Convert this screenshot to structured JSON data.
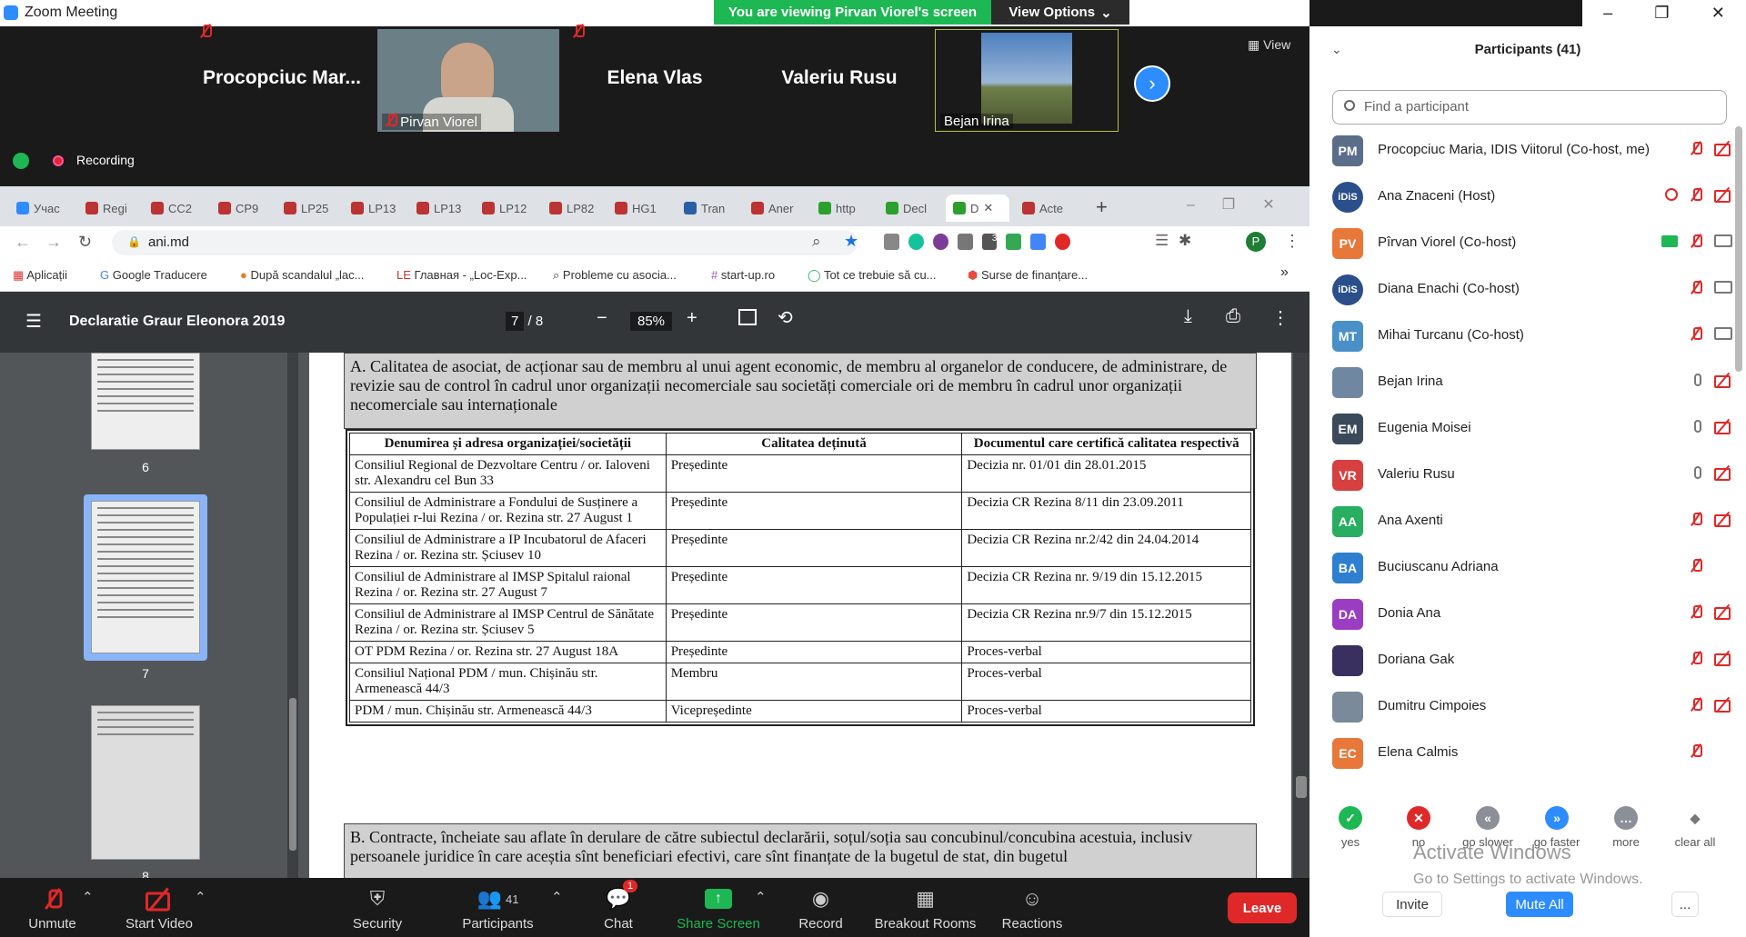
{
  "window": {
    "title": "Zoom Meeting"
  },
  "banner": {
    "viewing": "You are viewing Pirvan Viorel's screen",
    "view_options": "View Options"
  },
  "strip": {
    "tiles": [
      {
        "name": "Procopciuc Mar...",
        "caption": ""
      },
      {
        "name": "",
        "caption": "Pirvan Viorel"
      },
      {
        "name": "Elena Vlas",
        "caption": ""
      },
      {
        "name": "Valeriu Rusu",
        "caption": ""
      },
      {
        "name": "",
        "caption": "Bejan Irina"
      }
    ],
    "view_label": "View"
  },
  "recording": {
    "label": "Recording"
  },
  "browser": {
    "tabs": [
      "Учас",
      "Regi",
      "CC2",
      "CP9",
      "LP25",
      "LP13",
      "LP13",
      "LP12",
      "LP82",
      "HG1",
      "Tran",
      "Aner",
      "http",
      "Decl",
      "D",
      "Acte"
    ],
    "url": "ani.md",
    "bookmarks": [
      "Aplicații",
      "Google Traducere",
      "După scandalul „lac...",
      "Главная - „Loc-Exp...",
      "Probleme cu asocia...",
      "start-up.ro",
      "Tot ce trebuie să cu...",
      "Surse de finanțare..."
    ],
    "profile_initial": "P",
    "ext_badge": "3"
  },
  "pdf": {
    "doc_title": "Declaratie Graur Eleonora 2019",
    "page_current": "7",
    "page_total": "/ 8",
    "zoom": "85%",
    "thumbs": [
      "6",
      "7",
      "8"
    ],
    "section_a": "A. Calitatea de asociat, de acționar sau de membru al unui agent economic, de membru al organelor de conducere, de administrare, de revizie sau de control în cadrul unor organizații necomerciale sau societăți comerciale ori de membru în cadrul unor organizații necomerciale sau internaționale",
    "headers": [
      "Denumirea și adresa organizației/societății",
      "Calitatea deținută",
      "Documentul care certifică calitatea respectivă"
    ],
    "rows": [
      [
        "Consiliul Regional de Dezvoltare Centru / or. Ialoveni str. Alexandru cel Bun 33",
        "Președinte",
        "Decizia nr. 01/01 din 28.01.2015"
      ],
      [
        "Consiliul de Administrare a Fondului de Susținere a Populației r-lui Rezina / or. Rezina str. 27 August 1",
        "Președinte",
        "Decizia CR Rezina 8/11 din 23.09.2011"
      ],
      [
        "Consiliul de Administrare a IP Incubatorul de Afaceri Rezina / or. Rezina str. Șciusev 10",
        "Președinte",
        "Decizia CR Rezina nr.2/42 din 24.04.2014"
      ],
      [
        "Consiliul de Administrare al IMSP Spitalul raional Rezina / or. Rezina str. 27 August 7",
        "Președinte",
        "Decizia CR Rezina nr. 9/19 din 15.12.2015"
      ],
      [
        "Consiliul de Administrare al IMSP Centrul de Sănătate Rezina / or. Rezina str. Șciusev 5",
        "Președinte",
        "Decizia CR Rezina nr.9/7 din 15.12.2015"
      ],
      [
        "OT PDM Rezina / or. Rezina str. 27 August 18A",
        "Președinte",
        "Proces-verbal"
      ],
      [
        "Consiliul Național PDM / mun. Chișinău str. Armenească 44/3",
        "Membru",
        "Proces-verbal"
      ],
      [
        "PDM / mun. Chișinău str. Armenească 44/3",
        "Vicepreședinte",
        "Proces-verbal"
      ]
    ],
    "section_b": "B. Contracte, încheiate sau aflate în derulare de către subiectul declarării, soțul/soția sau concubinul/concubina acestuia, inclusiv persoanele juridice în care aceștia sînt beneficiari efectivi, care sînt finanțate de la bugetul de stat, din bugetul"
  },
  "toolbar": {
    "unmute": "Unmute",
    "start_video": "Start Video",
    "security": "Security",
    "participants": "Participants",
    "participants_count": "41",
    "chat": "Chat",
    "chat_badge": "1",
    "share_screen": "Share Screen",
    "record": "Record",
    "breakout": "Breakout Rooms",
    "reactions": "Reactions",
    "leave": "Leave"
  },
  "panel": {
    "title": "Participants (41)",
    "search_placeholder": "Find a participant",
    "participants": [
      {
        "initials": "PM",
        "name": "Procopciuc Maria, IDIS Viitorul (Co-host, me)",
        "color": "#5a6e8a",
        "mic": "off",
        "video": "off"
      },
      {
        "initials": "iDiS",
        "name": "Ana Znaceni (Host)",
        "color": "#2a4f8a",
        "mic": "off",
        "video": "off"
      },
      {
        "initials": "PV",
        "name": "Pîrvan Viorel (Co-host)",
        "color": "#e8783a",
        "mic": "off",
        "video": "on"
      },
      {
        "initials": "iDiS",
        "name": "Diana Enachi (Co-host)",
        "color": "#2a4f8a",
        "mic": "off",
        "video": "on"
      },
      {
        "initials": "MT",
        "name": "Mihai Turcanu (Co-host)",
        "color": "#4a90c8",
        "mic": "off",
        "video": "on"
      },
      {
        "initials": "",
        "name": "Bejan Irina",
        "color": "#6f87a0",
        "mic": "on",
        "video": "off"
      },
      {
        "initials": "EM",
        "name": "Eugenia Moisei",
        "color": "#3a4a5a",
        "mic": "on",
        "video": "off"
      },
      {
        "initials": "VR",
        "name": "Valeriu Rusu",
        "color": "#d64040",
        "mic": "on",
        "video": "off"
      },
      {
        "initials": "AA",
        "name": "Ana Axenti",
        "color": "#27ae60",
        "mic": "off",
        "video": "off"
      },
      {
        "initials": "BA",
        "name": "Buciuscanu Adriana",
        "color": "#2f7fd0",
        "mic": "off",
        "video": ""
      },
      {
        "initials": "DA",
        "name": "Donia Ana",
        "color": "#9b3dc2",
        "mic": "off",
        "video": "off"
      },
      {
        "initials": "",
        "name": "Doriana Gak",
        "color": "#3a3060",
        "mic": "off",
        "video": "off"
      },
      {
        "initials": "",
        "name": "Dumitru Cimpoies",
        "color": "#7a8a9a",
        "mic": "off",
        "video": "off"
      },
      {
        "initials": "EC",
        "name": "Elena Calmis",
        "color": "#e8783a",
        "mic": "off",
        "video": ""
      }
    ],
    "reactions": [
      "yes",
      "no",
      "go slower",
      "go faster",
      "more",
      "clear all"
    ],
    "invite": "Invite",
    "mute_all": "Mute All",
    "more": "...",
    "watermark1": "Activate Windows",
    "watermark2": "Go to Settings to activate Windows."
  }
}
